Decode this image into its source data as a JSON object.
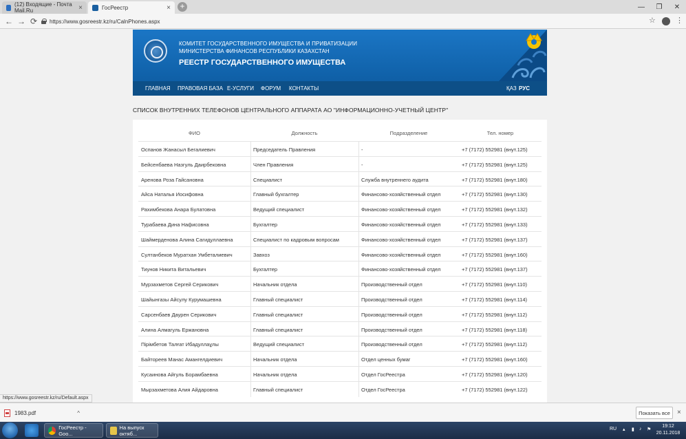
{
  "browser": {
    "tabs": [
      {
        "title": "(12) Входящие - Почта Mail.Ru",
        "active": false
      },
      {
        "title": "ГосРеестр",
        "active": true
      }
    ],
    "url": "https://www.gosreestr.kz/ru/CalnPhones.aspx",
    "status_url": "https://www.gosreestr.kz/ru/Default.aspx"
  },
  "banner": {
    "line1": "КОМИТЕТ ГОСУДАРСТВЕННОГО ИМУЩЕСТВА И ПРИВАТИЗАЦИИ",
    "line2": "МИНИСТЕРСТВА ФИНАНСОВ РЕСПУБЛИКИ КАЗАХСТАН",
    "title": "РЕЕСТР ГОСУДАРСТВЕННОГО ИМУЩЕСТВА"
  },
  "menu": [
    {
      "label": "ГЛАВНАЯ"
    },
    {
      "label": "ПРАВОВАЯ БАЗА"
    },
    {
      "label": "Е-УСЛУГИ"
    },
    {
      "label": "ФОРУМ"
    },
    {
      "label": "КОНТАКТЫ"
    }
  ],
  "langs": [
    {
      "label": "ҚАЗ",
      "active": false
    },
    {
      "label": "РУС",
      "active": true
    }
  ],
  "page": {
    "heading": "СПИСОК ВНУТРЕННИХ ТЕЛЕФОНОВ ЦЕНТРАЛЬНОГО АППАРАТА АО \"ИНФОРМАЦИОННО-УЧЕТНЫЙ ЦЕНТР\""
  },
  "table": {
    "headers": [
      "ФИО",
      "Должность",
      "Подразделение",
      "Тел. номер"
    ],
    "rows": [
      [
        "Оспанов Жанасыл Бегалиевич",
        "Председатель Правления",
        "-",
        "+7 (7172) 552981 (внут.125)"
      ],
      [
        "Бейсенбаева Назгуль Даирбековна",
        "Член Правления",
        "-",
        "+7 (7172) 552981 (внут.125)"
      ],
      [
        "Аренова Роза Гайсановна",
        "Специалист",
        "Служба внутреннего аудита",
        "+7 (7172) 552981 (внут.180)"
      ],
      [
        "Айса Наталья Иосифовна",
        "Главный бухгалтер",
        "Финансово-хозяйственный отдел",
        "+7 (7172) 552981 (внут.130)"
      ],
      [
        "Рахимбекова Анара Булатовна",
        "Ведущий специалист",
        "Финансово-хозяйственный отдел",
        "+7 (7172) 552981 (внут.132)"
      ],
      [
        "Турабаева Дина Нафисовна",
        "Бухгалтер",
        "Финансово-хозяйственный отдел",
        "+7 (7172) 552981 (внут.133)"
      ],
      [
        "Шаймерденова Алина Сагидуллаевна",
        "Специалист по кадровым вопросам",
        "Финансово-хозяйственный отдел",
        "+7 (7172) 552981 (внут.137)"
      ],
      [
        "Султанбеков Муратхан Умбеталиевич",
        "Завхоз",
        "Финансово-хозяйственный отдел",
        "+7 (7172) 552981 (внут.160)"
      ],
      [
        "Тиунов Никита Витальевич",
        "Бухгалтер",
        "Финансово-хозяйственный отдел",
        "+7 (7172) 552981 (внут.137)"
      ],
      [
        "Мурзахметов Сергей Серикович",
        "Начальник отдела",
        "Производственный отдел",
        "+7 (7172) 552981 (внут.110)"
      ],
      [
        "Шайынгазы Айсулу Курумашевна",
        "Главный специалист",
        "Производственный отдел",
        "+7 (7172) 552981 (внут.114)"
      ],
      [
        "Сарсенбаев Даурен Серикович",
        "Главный специалист",
        "Производственный отдел",
        "+7 (7172) 552981 (внут.112)"
      ],
      [
        "Алина Алмагуль Ержановна",
        "Главный специалист",
        "Производственный отдел",
        "+7 (7172) 552981 (внут.118)"
      ],
      [
        "Пірімбетов Талғат Ибадуллаұлы",
        "Ведущий специалист",
        "Производственный отдел",
        "+7 (7172) 552981 (внут.112)"
      ],
      [
        "Байтореев Манас Амангелдиевич",
        "Начальник отдела",
        "Отдел ценных бумаг",
        "+7 (7172) 552981 (внут.160)"
      ],
      [
        "Кусаинова Айгуль Борамбаевна",
        "Начальник отдела",
        "Отдел ГосРеестра",
        "+7 (7172) 552981 (внут.120)"
      ],
      [
        "Мырзахметова Алия Айдаровна",
        "Главный специалист",
        "Отдел ГосРеестра",
        "+7 (7172) 552981 (внут.122)"
      ]
    ]
  },
  "downloads": {
    "file": "1983.pdf",
    "show_all": "Показать все"
  },
  "taskbar": {
    "tasks": [
      {
        "label": "ГосРеестр - Goo..."
      },
      {
        "label": "На выпуск октяб..."
      }
    ],
    "lang": "RU",
    "time": "19:12",
    "date": "20.11.2018"
  },
  "icons": {
    "tab1": "mail-favicon",
    "tab2": "gosreestr-favicon",
    "back": "arrow-left-icon",
    "forward": "arrow-right-icon",
    "reload": "reload-icon",
    "star": "star-icon",
    "menu": "kebab-menu-icon"
  },
  "colors": {
    "banner": "#1b76c5",
    "navbar": "#0d4f87"
  }
}
